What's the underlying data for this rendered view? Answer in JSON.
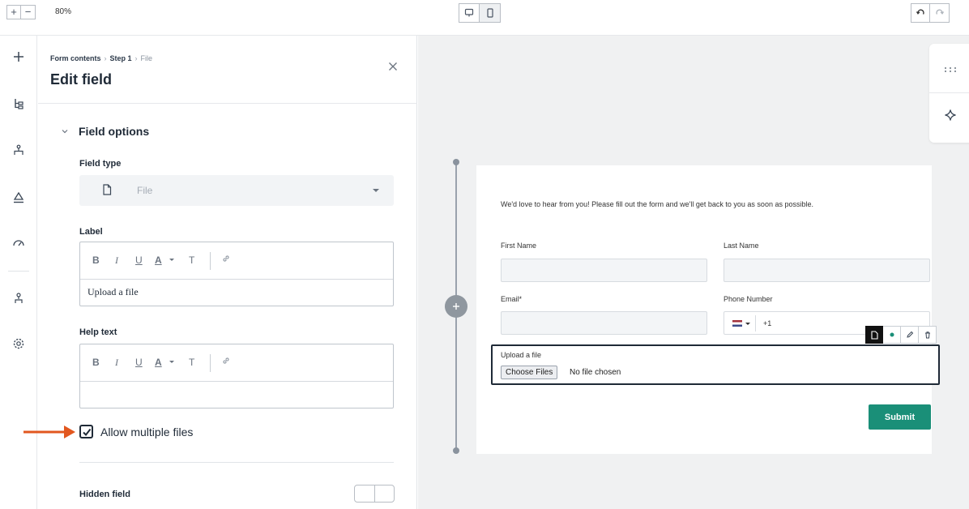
{
  "toolbar": {
    "zoom_in": "+",
    "zoom_out": "−",
    "zoom_level": "80%"
  },
  "panel": {
    "breadcrumb": [
      "Form contents",
      "Step 1",
      "File"
    ],
    "title": "Edit field",
    "section": "Field options",
    "field_type": {
      "label": "Field type",
      "value": "File"
    },
    "label_field": {
      "label": "Label",
      "value": "Upload a file"
    },
    "help_text_field": {
      "label": "Help text",
      "value": ""
    },
    "editor_toolbar": {
      "bold": "B",
      "italic": "I",
      "underline": "U",
      "text_color": "A",
      "clear_format": "T"
    },
    "allow_multiple": {
      "label": "Allow multiple files",
      "checked": true
    },
    "hidden_field": {
      "label": "Hidden field",
      "enabled": false
    }
  },
  "form": {
    "intro": "We'd love to hear from you! Please fill out the form and we'll get back to you as soon as possible.",
    "first_name": "First Name",
    "last_name": "Last Name",
    "email": "Email*",
    "phone": "Phone Number",
    "phone_code": "+1",
    "upload_label": "Upload a file",
    "choose_button": "Choose Files",
    "no_file": "No file chosen",
    "submit": "Submit"
  },
  "colors": {
    "accent": "#1a8f78",
    "arrow": "#e2571f",
    "text": "#1f2a37"
  }
}
